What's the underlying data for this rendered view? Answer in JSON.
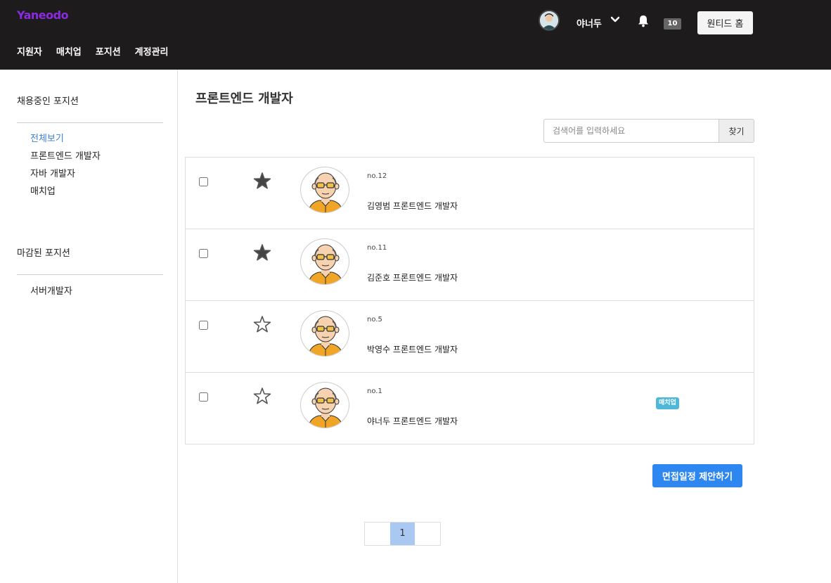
{
  "header": {
    "logo": "Yaneodo",
    "nav": [
      {
        "label": "지원자"
      },
      {
        "label": "매치업"
      },
      {
        "label": "포지션"
      },
      {
        "label": "계정관리"
      }
    ],
    "user_name": "야너두",
    "notification_count": "10",
    "home_button": "원티드 홈"
  },
  "sidebar": {
    "open_title": "채용중인 포지션",
    "open_items": [
      {
        "label": "전체보기",
        "active": true
      },
      {
        "label": "프론트엔드 개발자"
      },
      {
        "label": "자바 개발자"
      },
      {
        "label": "매치업"
      }
    ],
    "closed_title": "마감된 포지션",
    "closed_items": [
      {
        "label": "서버개발자"
      }
    ]
  },
  "main": {
    "title": "프론트엔드 개발자",
    "search": {
      "placeholder": "검색어를 입력하세요",
      "button": "찾기"
    },
    "applicants": [
      {
        "no": "no.12",
        "name": "김영범 프론트엔드 개발자",
        "starred": true,
        "checked": false,
        "badge": ""
      },
      {
        "no": "no.11",
        "name": "김준호 프론트엔드 개발자",
        "starred": true,
        "checked": false,
        "badge": ""
      },
      {
        "no": "no.5",
        "name": "박영수 프론트엔드 개발자",
        "starred": false,
        "checked": false,
        "badge": ""
      },
      {
        "no": "no.1",
        "name": "야너두 프론트엔드 개발자",
        "starred": false,
        "checked": false,
        "badge": "매치업"
      }
    ],
    "action_button": "면접일정 제안하기",
    "pagination": {
      "current_page": "1"
    }
  },
  "colors": {
    "header_bg": "#1d1b1c",
    "logo": "#8a2be2",
    "active_link": "#3b7fd8",
    "primary_button": "#2e86f0",
    "badge": "#4fb8d8",
    "current_page": "#a9c9f2"
  },
  "icons": {
    "star_filled": "star-filled-icon",
    "star_empty": "star-outline-icon",
    "bell": "bell-icon",
    "chevron": "chevron-down-icon",
    "avatar": "applicant-avatar-icon"
  }
}
